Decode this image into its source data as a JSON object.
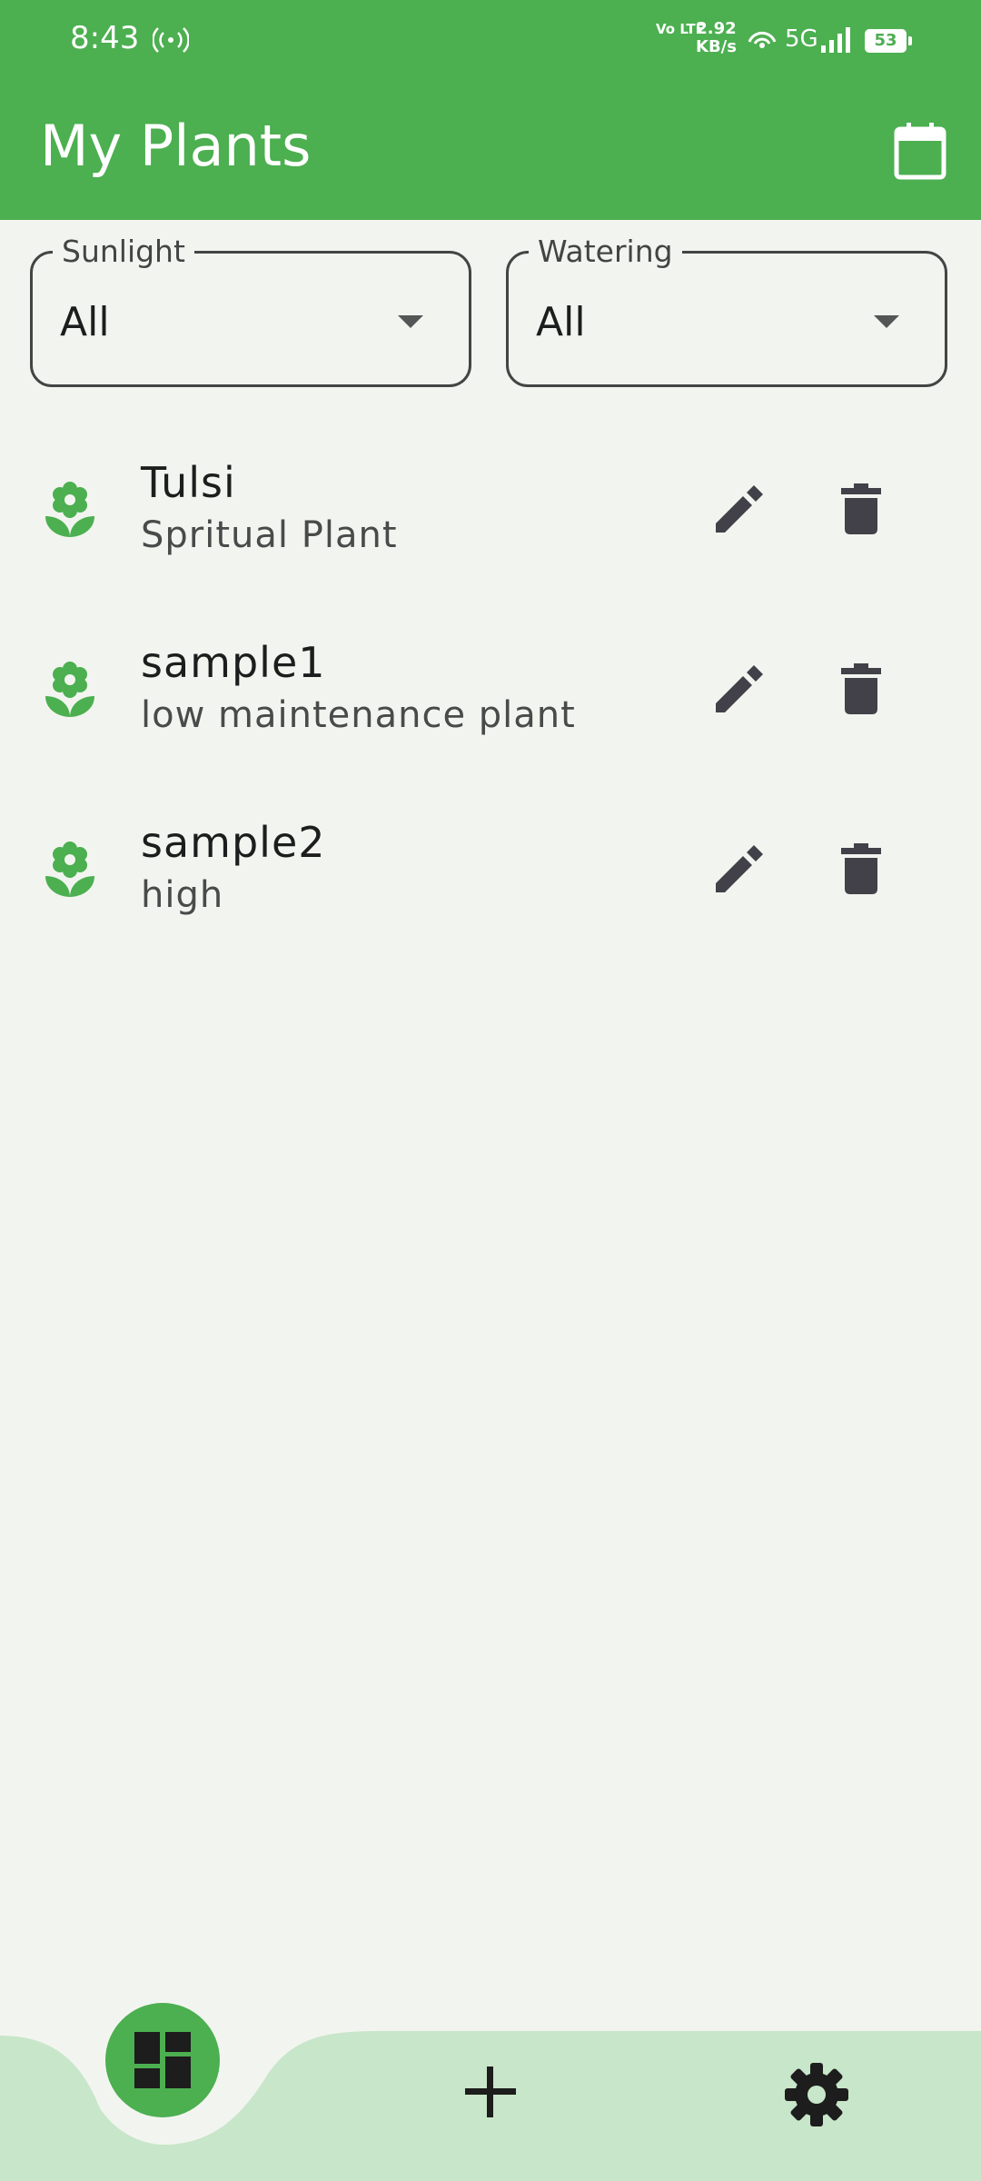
{
  "status_bar": {
    "time": "8:43",
    "volte": "Vo LTE",
    "speed_value": "2.92",
    "speed_unit": "KB/s",
    "network": "5G",
    "battery": "53",
    "icons": [
      "hotspot-icon",
      "wifi-icon",
      "signal-icon",
      "battery-icon"
    ]
  },
  "app_bar": {
    "title": "My Plants",
    "action_icon": "calendar-icon"
  },
  "filters": {
    "sunlight": {
      "label": "Sunlight",
      "value": "All"
    },
    "watering": {
      "label": "Watering",
      "value": "All"
    }
  },
  "plants": [
    {
      "name": "Tulsi",
      "description": "Spritual Plant"
    },
    {
      "name": "sample1",
      "description": "low maintenance plant"
    },
    {
      "name": "sample2",
      "description": "high"
    }
  ],
  "bottom_nav": {
    "items": [
      "dashboard-icon",
      "add-icon",
      "settings-icon"
    ],
    "active": "dashboard-icon"
  },
  "colors": {
    "primary": "#4caf50",
    "background": "#f2f5ef",
    "nav_background": "#c8e6c9",
    "icon_dark": "#424048"
  }
}
